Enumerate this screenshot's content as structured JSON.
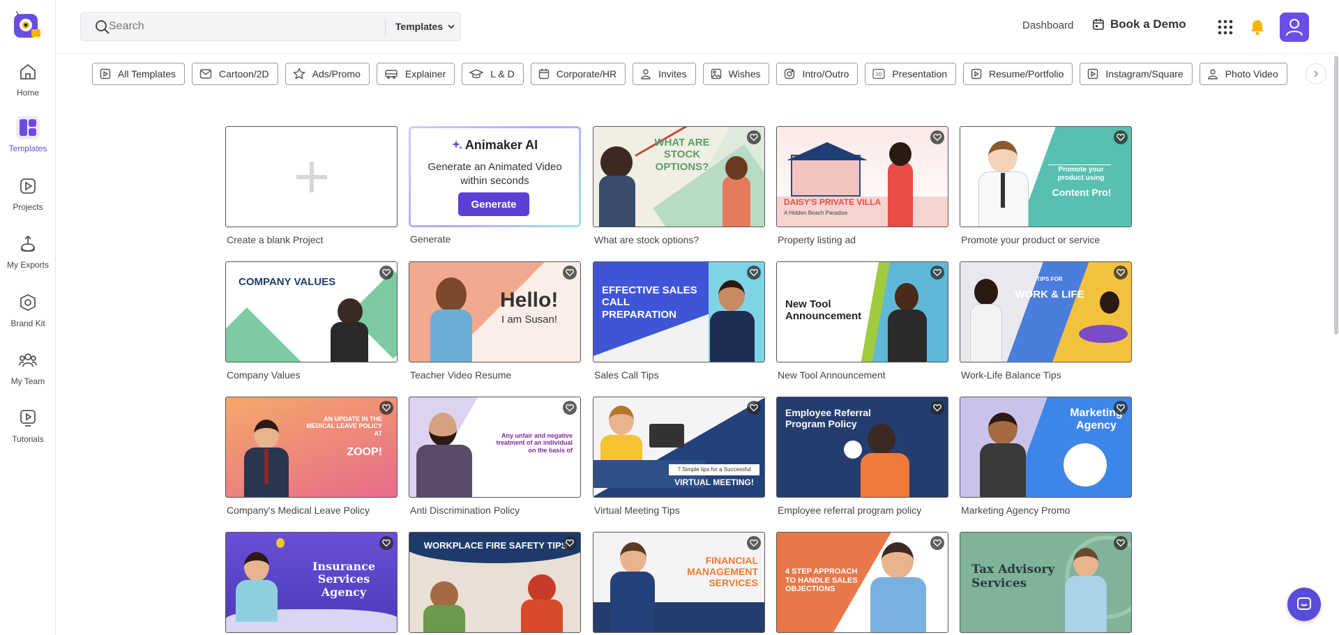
{
  "sidebar": {
    "items": [
      {
        "label": "Home",
        "icon": "home-icon"
      },
      {
        "label": "Templates",
        "icon": "templates-icon",
        "active": true
      },
      {
        "label": "Projects",
        "icon": "projects-icon"
      },
      {
        "label": "My Exports",
        "icon": "exports-icon"
      },
      {
        "label": "Brand Kit",
        "icon": "brand-kit-icon"
      },
      {
        "label": "My Team",
        "icon": "team-icon"
      },
      {
        "label": "Tutorials",
        "icon": "tutorials-icon"
      }
    ]
  },
  "header": {
    "search_placeholder": "Search",
    "search_scope": "Templates",
    "dashboard": "Dashboard",
    "book_demo": "Book a Demo"
  },
  "categories": [
    {
      "label": "All Templates",
      "icon": "play-square-icon"
    },
    {
      "label": "Cartoon/2D",
      "icon": "mail-icon"
    },
    {
      "label": "Ads/Promo",
      "icon": "star-icon"
    },
    {
      "label": "Explainer",
      "icon": "bus-icon"
    },
    {
      "label": "L & D",
      "icon": "graduation-cap-icon"
    },
    {
      "label": "Corporate/HR",
      "icon": "calendar-icon"
    },
    {
      "label": "Invites",
      "icon": "person-icon"
    },
    {
      "label": "Wishes",
      "icon": "image-icon"
    },
    {
      "label": "Intro/Outro",
      "icon": "instagram-icon"
    },
    {
      "label": "Presentation",
      "icon": "2d-icon"
    },
    {
      "label": "Resume/Portfolio",
      "icon": "play-square-icon"
    },
    {
      "label": "Instagram/Square",
      "icon": "play-square-icon"
    },
    {
      "label": "Photo Video",
      "icon": "person-icon"
    }
  ],
  "ai_card": {
    "title": "Animaker AI",
    "subtitle": "Generate an Animated Video within seconds",
    "button": "Generate"
  },
  "cards": [
    {
      "title": "Create a blank Project"
    },
    {
      "title": "Generate"
    },
    {
      "title": "What are stock options?",
      "thumb_text": "WHAT ARE STOCK OPTIONS?"
    },
    {
      "title": "Property listing ad",
      "thumb_text": "DAISY'S PRIVATE VILLA",
      "thumb_sub": "A Hidden Beach Paradise"
    },
    {
      "title": "Promote your product or service",
      "thumb_text": "Promote your product using",
      "thumb_sub": "Content Pro!"
    },
    {
      "title": "Company Values",
      "thumb_text": "COMPANY VALUES"
    },
    {
      "title": "Teacher Video Resume",
      "thumb_text": "Hello!",
      "thumb_sub": "I am Susan!"
    },
    {
      "title": "Sales Call Tips",
      "thumb_text": "EFFECTIVE SALES CALL PREPARATION"
    },
    {
      "title": "New Tool Announcement",
      "thumb_text": "New Tool Announcement"
    },
    {
      "title": "Work-Life Balance Tips",
      "thumb_text": "WORK & LIFE",
      "thumb_sub": "TIPS FOR"
    },
    {
      "title": "Company's Medical Leave Policy",
      "thumb_text": "AN UPDATE IN THE MEDICAL LEAVE POLICY AT",
      "thumb_sub": "ZOOP!"
    },
    {
      "title": "Anti Discrimination Policy",
      "thumb_text": "Any unfair and negative treatment of an individual on the basis of"
    },
    {
      "title": "Virtual Meeting Tips",
      "thumb_text": "VIRTUAL MEETING!",
      "thumb_sub": "7 Simple tips for a Successful"
    },
    {
      "title": "Employee referral program policy",
      "thumb_text": "Employee Referral Program Policy"
    },
    {
      "title": "Marketing Agency Promo",
      "thumb_text": "Marketing Agency"
    },
    {
      "title": "",
      "thumb_text": "Insurance Services Agency"
    },
    {
      "title": "",
      "thumb_text": "WORKPLACE FIRE SAFETY TIPS"
    },
    {
      "title": "",
      "thumb_text": "FINANCIAL MANAGEMENT SERVICES"
    },
    {
      "title": "",
      "thumb_text": "4 STEP APPROACH TO HANDLE SALES OBJECTIONS"
    },
    {
      "title": "",
      "thumb_text": "Tax Advisory Services"
    }
  ],
  "colors": {
    "accent": "#5b3fd6",
    "bell": "#f5b400"
  }
}
